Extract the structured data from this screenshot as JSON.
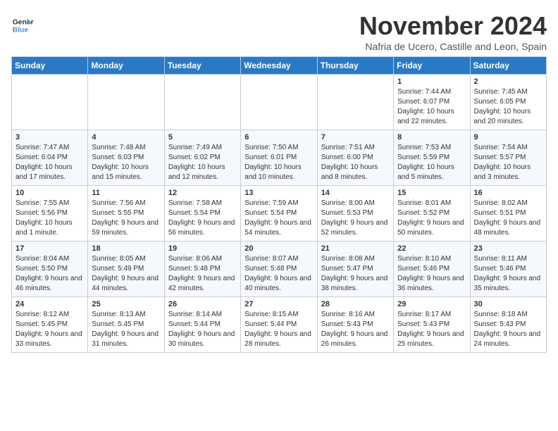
{
  "logo": {
    "line1": "General",
    "line2": "Blue"
  },
  "title": "November 2024",
  "subtitle": "Nafria de Ucero, Castille and Leon, Spain",
  "weekdays": [
    "Sunday",
    "Monday",
    "Tuesday",
    "Wednesday",
    "Thursday",
    "Friday",
    "Saturday"
  ],
  "weeks": [
    [
      {
        "day": "",
        "info": ""
      },
      {
        "day": "",
        "info": ""
      },
      {
        "day": "",
        "info": ""
      },
      {
        "day": "",
        "info": ""
      },
      {
        "day": "",
        "info": ""
      },
      {
        "day": "1",
        "info": "Sunrise: 7:44 AM\nSunset: 6:07 PM\nDaylight: 10 hours and 22 minutes."
      },
      {
        "day": "2",
        "info": "Sunrise: 7:45 AM\nSunset: 6:05 PM\nDaylight: 10 hours and 20 minutes."
      }
    ],
    [
      {
        "day": "3",
        "info": "Sunrise: 7:47 AM\nSunset: 6:04 PM\nDaylight: 10 hours and 17 minutes."
      },
      {
        "day": "4",
        "info": "Sunrise: 7:48 AM\nSunset: 6:03 PM\nDaylight: 10 hours and 15 minutes."
      },
      {
        "day": "5",
        "info": "Sunrise: 7:49 AM\nSunset: 6:02 PM\nDaylight: 10 hours and 12 minutes."
      },
      {
        "day": "6",
        "info": "Sunrise: 7:50 AM\nSunset: 6:01 PM\nDaylight: 10 hours and 10 minutes."
      },
      {
        "day": "7",
        "info": "Sunrise: 7:51 AM\nSunset: 6:00 PM\nDaylight: 10 hours and 8 minutes."
      },
      {
        "day": "8",
        "info": "Sunrise: 7:53 AM\nSunset: 5:59 PM\nDaylight: 10 hours and 5 minutes."
      },
      {
        "day": "9",
        "info": "Sunrise: 7:54 AM\nSunset: 5:57 PM\nDaylight: 10 hours and 3 minutes."
      }
    ],
    [
      {
        "day": "10",
        "info": "Sunrise: 7:55 AM\nSunset: 5:56 PM\nDaylight: 10 hours and 1 minute."
      },
      {
        "day": "11",
        "info": "Sunrise: 7:56 AM\nSunset: 5:55 PM\nDaylight: 9 hours and 59 minutes."
      },
      {
        "day": "12",
        "info": "Sunrise: 7:58 AM\nSunset: 5:54 PM\nDaylight: 9 hours and 56 minutes."
      },
      {
        "day": "13",
        "info": "Sunrise: 7:59 AM\nSunset: 5:54 PM\nDaylight: 9 hours and 54 minutes."
      },
      {
        "day": "14",
        "info": "Sunrise: 8:00 AM\nSunset: 5:53 PM\nDaylight: 9 hours and 52 minutes."
      },
      {
        "day": "15",
        "info": "Sunrise: 8:01 AM\nSunset: 5:52 PM\nDaylight: 9 hours and 50 minutes."
      },
      {
        "day": "16",
        "info": "Sunrise: 8:02 AM\nSunset: 5:51 PM\nDaylight: 9 hours and 48 minutes."
      }
    ],
    [
      {
        "day": "17",
        "info": "Sunrise: 8:04 AM\nSunset: 5:50 PM\nDaylight: 9 hours and 46 minutes."
      },
      {
        "day": "18",
        "info": "Sunrise: 8:05 AM\nSunset: 5:49 PM\nDaylight: 9 hours and 44 minutes."
      },
      {
        "day": "19",
        "info": "Sunrise: 8:06 AM\nSunset: 5:48 PM\nDaylight: 9 hours and 42 minutes."
      },
      {
        "day": "20",
        "info": "Sunrise: 8:07 AM\nSunset: 5:48 PM\nDaylight: 9 hours and 40 minutes."
      },
      {
        "day": "21",
        "info": "Sunrise: 8:08 AM\nSunset: 5:47 PM\nDaylight: 9 hours and 38 minutes."
      },
      {
        "day": "22",
        "info": "Sunrise: 8:10 AM\nSunset: 5:46 PM\nDaylight: 9 hours and 36 minutes."
      },
      {
        "day": "23",
        "info": "Sunrise: 8:11 AM\nSunset: 5:46 PM\nDaylight: 9 hours and 35 minutes."
      }
    ],
    [
      {
        "day": "24",
        "info": "Sunrise: 8:12 AM\nSunset: 5:45 PM\nDaylight: 9 hours and 33 minutes."
      },
      {
        "day": "25",
        "info": "Sunrise: 8:13 AM\nSunset: 5:45 PM\nDaylight: 9 hours and 31 minutes."
      },
      {
        "day": "26",
        "info": "Sunrise: 8:14 AM\nSunset: 5:44 PM\nDaylight: 9 hours and 30 minutes."
      },
      {
        "day": "27",
        "info": "Sunrise: 8:15 AM\nSunset: 5:44 PM\nDaylight: 9 hours and 28 minutes."
      },
      {
        "day": "28",
        "info": "Sunrise: 8:16 AM\nSunset: 5:43 PM\nDaylight: 9 hours and 26 minutes."
      },
      {
        "day": "29",
        "info": "Sunrise: 8:17 AM\nSunset: 5:43 PM\nDaylight: 9 hours and 25 minutes."
      },
      {
        "day": "30",
        "info": "Sunrise: 8:18 AM\nSunset: 5:43 PM\nDaylight: 9 hours and 24 minutes."
      }
    ]
  ]
}
